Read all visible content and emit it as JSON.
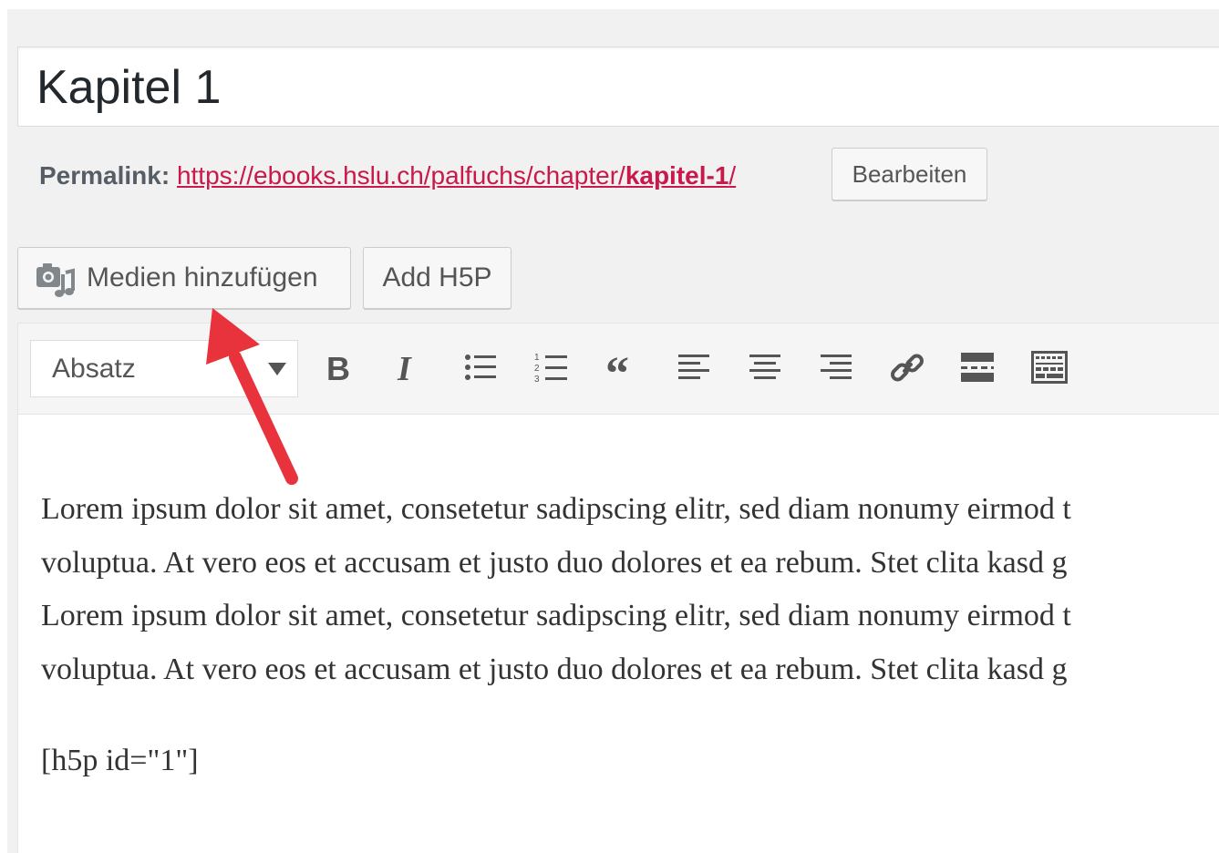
{
  "post": {
    "title": "Kapitel 1"
  },
  "permalink": {
    "label": "Permalink:",
    "url_base": "https://ebooks.hslu.ch/palfuchs/chapter/",
    "url_slug": "kapitel-1",
    "url_tail": "/",
    "edit_button": "Bearbeiten"
  },
  "media_buttons": {
    "add_media": "Medien hinzufügen",
    "add_h5p": "Add H5P"
  },
  "toolbar": {
    "format_select_value": "Absatz",
    "buttons": [
      "bold-icon",
      "italic-icon",
      "bulleted-list-icon",
      "numbered-list-icon",
      "blockquote-icon",
      "align-left-icon",
      "align-center-icon",
      "align-right-icon",
      "link-icon",
      "read-more-icon",
      "toolbar-toggle-icon"
    ]
  },
  "content": {
    "lines": [
      "Lorem ipsum dolor sit amet, consetetur sadipscing elitr, sed diam nonumy eirmod t",
      "voluptua. At vero eos et accusam et justo duo dolores et ea rebum. Stet clita kasd g",
      "Lorem ipsum dolor sit amet, consetetur sadipscing elitr, sed diam nonumy eirmod t",
      "voluptua. At vero eos et accusam et justo duo dolores et ea rebum. Stet clita kasd g"
    ],
    "shortcode": "[h5p id=\"1\"]"
  },
  "colors": {
    "link": "#c9184a",
    "arrow": "#e8323c",
    "background": "#f1f1f1"
  }
}
